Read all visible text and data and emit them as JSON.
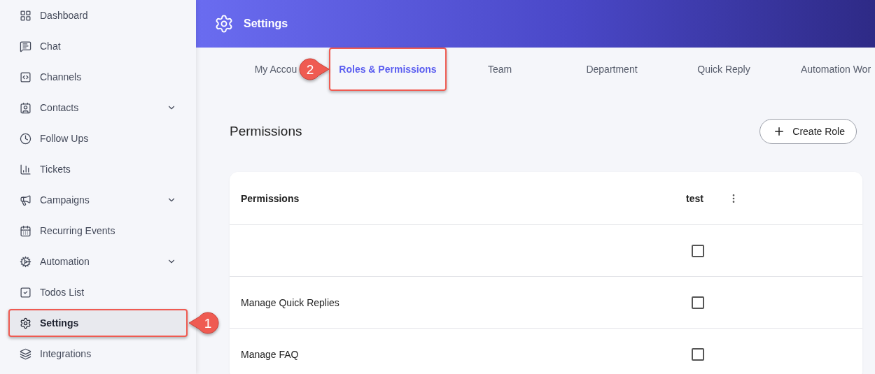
{
  "sidebar": {
    "items": [
      {
        "label": "Dashboard",
        "expandable": false,
        "selected": false,
        "highlighted": false
      },
      {
        "label": "Chat",
        "expandable": false,
        "selected": false,
        "highlighted": false
      },
      {
        "label": "Channels",
        "expandable": false,
        "selected": false,
        "highlighted": false
      },
      {
        "label": "Contacts",
        "expandable": true,
        "selected": false,
        "highlighted": false
      },
      {
        "label": "Follow Ups",
        "expandable": false,
        "selected": false,
        "highlighted": false
      },
      {
        "label": "Tickets",
        "expandable": false,
        "selected": false,
        "highlighted": false
      },
      {
        "label": "Campaigns",
        "expandable": true,
        "selected": false,
        "highlighted": false
      },
      {
        "label": "Recurring Events",
        "expandable": false,
        "selected": false,
        "highlighted": false
      },
      {
        "label": "Automation",
        "expandable": true,
        "selected": false,
        "highlighted": false
      },
      {
        "label": "Todos List",
        "expandable": false,
        "selected": false,
        "highlighted": false
      },
      {
        "label": "Settings",
        "expandable": false,
        "selected": true,
        "highlighted": true,
        "callout": "1"
      },
      {
        "label": "Integrations",
        "expandable": false,
        "selected": false,
        "highlighted": false
      }
    ]
  },
  "header": {
    "title": "Settings"
  },
  "tabs": [
    {
      "label": "My Accou",
      "selected": false,
      "highlighted": false
    },
    {
      "label": "Roles & Permissions",
      "selected": true,
      "highlighted": true,
      "callout": "2"
    },
    {
      "label": "Team",
      "selected": false,
      "highlighted": false
    },
    {
      "label": "Department",
      "selected": false,
      "highlighted": false
    },
    {
      "label": "Quick Reply",
      "selected": false,
      "highlighted": false
    },
    {
      "label": "Automation Wor",
      "selected": false,
      "highlighted": false
    }
  ],
  "section": {
    "title": "Permissions",
    "button": "Create Role"
  },
  "table": {
    "columns": [
      "Permissions",
      "test"
    ],
    "rows": [
      {
        "checked": false
      },
      {
        "name": "Manage Quick Replies",
        "checked": false
      },
      {
        "name": "Manage FAQ",
        "checked": false
      }
    ]
  }
}
